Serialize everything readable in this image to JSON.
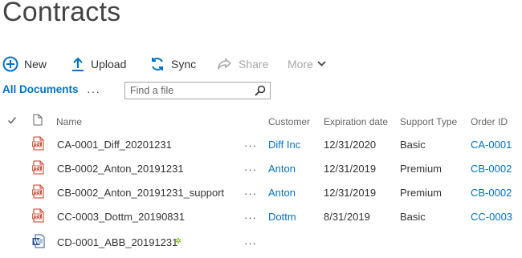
{
  "page": {
    "title": "Contracts"
  },
  "toolbar": {
    "new_label": "New",
    "upload_label": "Upload",
    "sync_label": "Sync",
    "share_label": "Share",
    "more_label": "More"
  },
  "views": {
    "current": "All Documents",
    "more": "···"
  },
  "search": {
    "placeholder": "Find a file",
    "value": ""
  },
  "columns": {
    "name": "Name",
    "customer": "Customer",
    "expiration": "Expiration date",
    "support_type": "Support Type",
    "order_id": "Order ID"
  },
  "rows": [
    {
      "name": "CA-0001_Diff_20201231",
      "customer": "Diff Inc",
      "expiration": "12/31/2020",
      "support_type": "Basic",
      "order_id": "CA-0001",
      "icon": "pdf-file-icon"
    },
    {
      "name": "CB-0002_Anton_20191231",
      "customer": "Anton",
      "expiration": "12/31/2019",
      "support_type": "Premium",
      "order_id": "CB-0002",
      "icon": "pdf-file-icon"
    },
    {
      "name": "CB-0002_Anton_20191231_support",
      "customer": "Anton",
      "expiration": "12/31/2019",
      "support_type": "Premium",
      "order_id": "CB-0002",
      "icon": "pdf-file-icon"
    },
    {
      "name": "CC-0003_Dottm_20190831",
      "customer": "Dottm",
      "expiration": "8/31/2019",
      "support_type": "Basic",
      "order_id": "CC-0003",
      "icon": "pdf-file-icon"
    },
    {
      "name": "CD-0001_ABB_20191231",
      "customer": "",
      "expiration": "",
      "support_type": "",
      "order_id": "",
      "icon": "word-file-icon",
      "new_marker": "✲"
    }
  ],
  "row_more": "···",
  "colors": {
    "accent": "#0072c6",
    "pdf": "#c23b22",
    "word": "#2b579a",
    "new": "#6bb700"
  }
}
